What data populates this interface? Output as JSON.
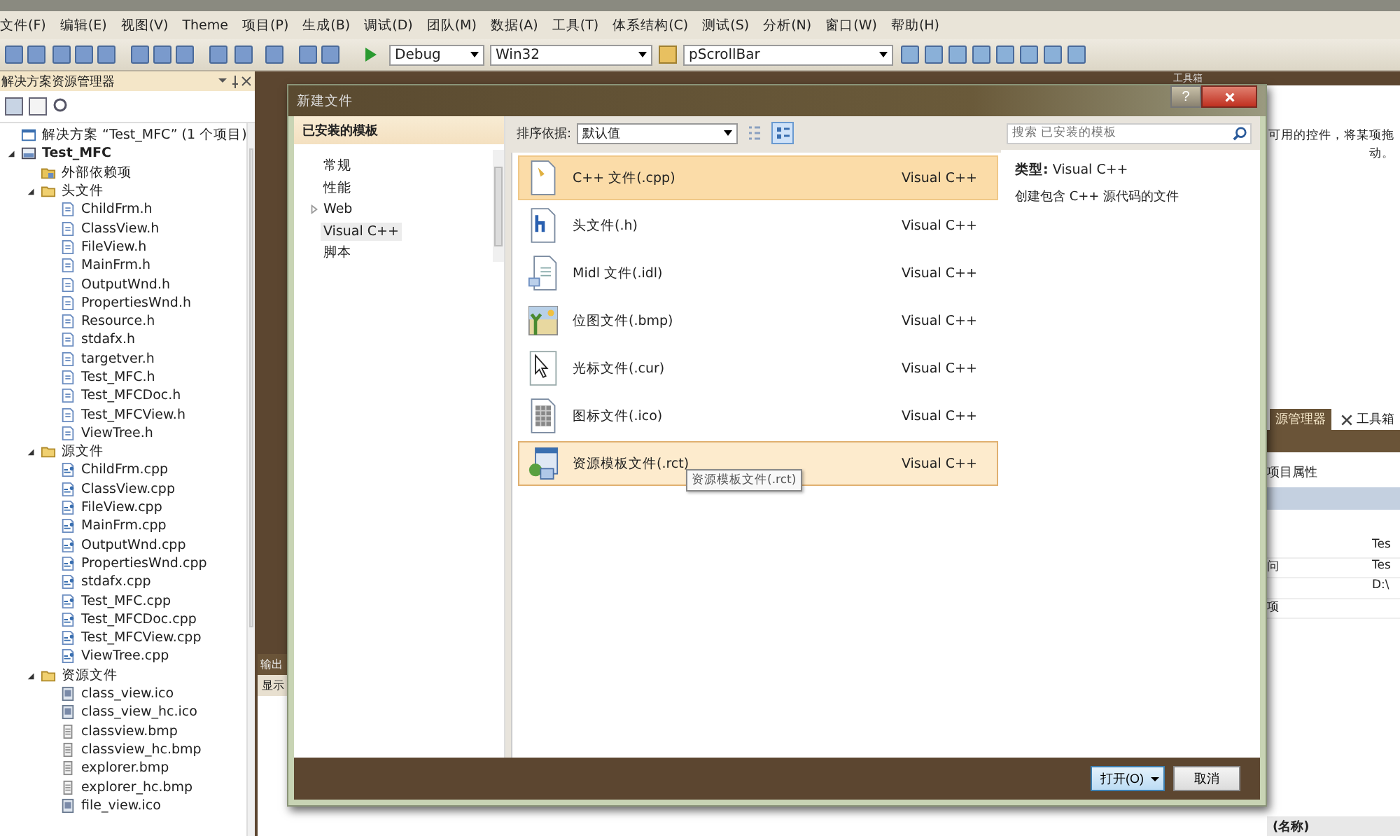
{
  "menu": [
    "文件(F)",
    "编辑(E)",
    "视图(V)",
    "Theme",
    "项目(P)",
    "生成(B)",
    "调试(D)",
    "团队(M)",
    "数据(A)",
    "工具(T)",
    "体系结构(C)",
    "测试(S)",
    "分析(N)",
    "窗口(W)",
    "帮助(H)"
  ],
  "toolbar": {
    "configuration": "Debug",
    "platform": "Win32",
    "find": "pScrollBar"
  },
  "solution_explorer": {
    "title": "解决方案资源管理器",
    "tree": [
      {
        "label": "解决方案 “Test_MFC” (1 个项目)",
        "kind": "solution",
        "children": [
          {
            "label": "Test_MFC",
            "kind": "project",
            "expanded": true,
            "children": [
              {
                "label": "外部依赖项",
                "kind": "dependencies"
              },
              {
                "label": "头文件",
                "kind": "folder",
                "expanded": true,
                "children": [
                  {
                    "label": "ChildFrm.h",
                    "kind": "header"
                  },
                  {
                    "label": "ClassView.h",
                    "kind": "header"
                  },
                  {
                    "label": "FileView.h",
                    "kind": "header"
                  },
                  {
                    "label": "MainFrm.h",
                    "kind": "header"
                  },
                  {
                    "label": "OutputWnd.h",
                    "kind": "header"
                  },
                  {
                    "label": "PropertiesWnd.h",
                    "kind": "header"
                  },
                  {
                    "label": "Resource.h",
                    "kind": "header"
                  },
                  {
                    "label": "stdafx.h",
                    "kind": "header"
                  },
                  {
                    "label": "targetver.h",
                    "kind": "header"
                  },
                  {
                    "label": "Test_MFC.h",
                    "kind": "header"
                  },
                  {
                    "label": "Test_MFCDoc.h",
                    "kind": "header"
                  },
                  {
                    "label": "Test_MFCView.h",
                    "kind": "header"
                  },
                  {
                    "label": "ViewTree.h",
                    "kind": "header"
                  }
                ]
              },
              {
                "label": "源文件",
                "kind": "folder",
                "expanded": true,
                "children": [
                  {
                    "label": "ChildFrm.cpp",
                    "kind": "source"
                  },
                  {
                    "label": "ClassView.cpp",
                    "kind": "source"
                  },
                  {
                    "label": "FileView.cpp",
                    "kind": "source"
                  },
                  {
                    "label": "MainFrm.cpp",
                    "kind": "source"
                  },
                  {
                    "label": "OutputWnd.cpp",
                    "kind": "source"
                  },
                  {
                    "label": "PropertiesWnd.cpp",
                    "kind": "source"
                  },
                  {
                    "label": "stdafx.cpp",
                    "kind": "source"
                  },
                  {
                    "label": "Test_MFC.cpp",
                    "kind": "source"
                  },
                  {
                    "label": "Test_MFCDoc.cpp",
                    "kind": "source"
                  },
                  {
                    "label": "Test_MFCView.cpp",
                    "kind": "source"
                  },
                  {
                    "label": "ViewTree.cpp",
                    "kind": "source"
                  }
                ]
              },
              {
                "label": "资源文件",
                "kind": "folder",
                "expanded": true,
                "children": [
                  {
                    "label": "class_view.ico",
                    "kind": "icon"
                  },
                  {
                    "label": "class_view_hc.ico",
                    "kind": "icon"
                  },
                  {
                    "label": "classview.bmp",
                    "kind": "bitmap"
                  },
                  {
                    "label": "classview_hc.bmp",
                    "kind": "bitmap"
                  },
                  {
                    "label": "explorer.bmp",
                    "kind": "bitmap"
                  },
                  {
                    "label": "explorer_hc.bmp",
                    "kind": "bitmap"
                  },
                  {
                    "label": "file_view.ico",
                    "kind": "icon"
                  }
                ]
              }
            ]
          }
        ]
      }
    ]
  },
  "output_panel": {
    "title": "输出",
    "label": "显示"
  },
  "right_panel": {
    "title": "工具箱",
    "hint_lines": [
      "可用的控件，将某项拖",
      "动。"
    ],
    "tabs": [
      {
        "label": "源管理器",
        "selected": true
      },
      {
        "label": "工具箱",
        "selected": false
      }
    ],
    "properties_title": "项目属性",
    "rows": [
      {
        "value": "Tes"
      },
      {
        "label": "问",
        "value": "Tes"
      },
      {
        "value": "D:\\"
      },
      {
        "label": "项"
      }
    ],
    "bottom_label": "(名称)"
  },
  "dialog": {
    "title": "新建文件",
    "help": "?",
    "installed_header": "已安装的模板",
    "categories": [
      {
        "label": "常规",
        "selected": false
      },
      {
        "label": "性能",
        "selected": false
      },
      {
        "label": "Web",
        "selected": false,
        "expanded": false
      },
      {
        "label": "Visual C++",
        "selected": true
      },
      {
        "label": "脚本",
        "selected": false
      }
    ],
    "sort_label": "排序依据:",
    "sort_value": "默认值",
    "views": [
      {
        "kind": "small",
        "selected": false
      },
      {
        "kind": "medium",
        "selected": true
      }
    ],
    "search_placeholder": "搜索 已安装的模板",
    "templates": [
      {
        "name": "C++ 文件(.cpp)",
        "type": "Visual C++",
        "kind": "cpp",
        "selected": true,
        "hovered": false
      },
      {
        "name": "头文件(.h)",
        "type": "Visual C++",
        "kind": "h",
        "selected": false,
        "hovered": false
      },
      {
        "name": "Midl 文件(.idl)",
        "type": "Visual C++",
        "kind": "idl",
        "selected": false,
        "hovered": false
      },
      {
        "name": "位图文件(.bmp)",
        "type": "Visual C++",
        "kind": "bmp",
        "selected": false,
        "hovered": false
      },
      {
        "name": "光标文件(.cur)",
        "type": "Visual C++",
        "kind": "cur",
        "selected": false,
        "hovered": false
      },
      {
        "name": "图标文件(.ico)",
        "type": "Visual C++",
        "kind": "ico",
        "selected": false,
        "hovered": false
      },
      {
        "name": "资源模板文件(.rct)",
        "type": "Visual C++",
        "kind": "rct",
        "selected": false,
        "hovered": true
      }
    ],
    "tooltip": "资源模板文件(.rct)",
    "detail_type": "**类型:** Visual C++",
    "description": "创建包含 C++ 源代码的文件",
    "buttons": {
      "open": "打开(O)",
      "cancel": "取消"
    }
  }
}
